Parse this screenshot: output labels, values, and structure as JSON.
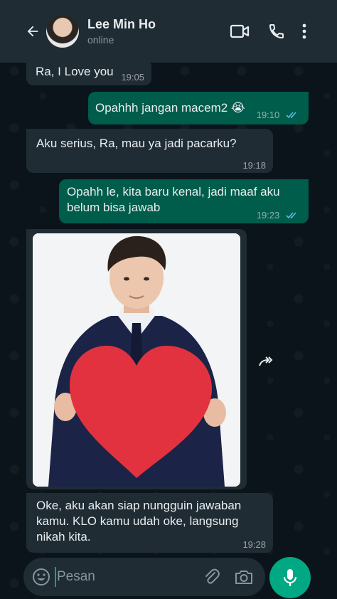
{
  "header": {
    "back_icon": "arrow-left-icon",
    "contact_name": "Lee Min Ho",
    "contact_status": "online",
    "icons": [
      "video-call-icon",
      "phone-icon",
      "more-vert-icon"
    ]
  },
  "messages": [
    {
      "direction": "in",
      "text": "Ra, I Love you",
      "time": "19:05"
    },
    {
      "direction": "out",
      "text": "Opahhh jangan macem2 😭",
      "time": "19:10",
      "status": "read"
    },
    {
      "direction": "in",
      "text": "Aku serius, Ra, mau ya jadi pacarku?",
      "time": "19:18"
    },
    {
      "direction": "out",
      "text": "Opahh le, kita baru kenal, jadi maaf aku belum bisa jawab",
      "time": "19:23",
      "status": "read"
    },
    {
      "direction": "in",
      "type": "image",
      "image_desc": "man in suit holding red heart"
    },
    {
      "direction": "in",
      "text": "Oke, aku akan siap nungguin jawaban kamu. KLO kamu udah oke, langsung nikah kita.",
      "time": "19:28"
    }
  ],
  "composer": {
    "placeholder": "Pesan",
    "icons": [
      "emoji-icon",
      "attach-icon",
      "camera-icon",
      "mic-icon"
    ]
  },
  "colors": {
    "background": "#0b141a",
    "header": "#1f2c34",
    "incoming_bubble": "#1f2c34",
    "outgoing_bubble": "#005c4b",
    "accent": "#00a884",
    "read_ticks": "#53bdeb"
  }
}
